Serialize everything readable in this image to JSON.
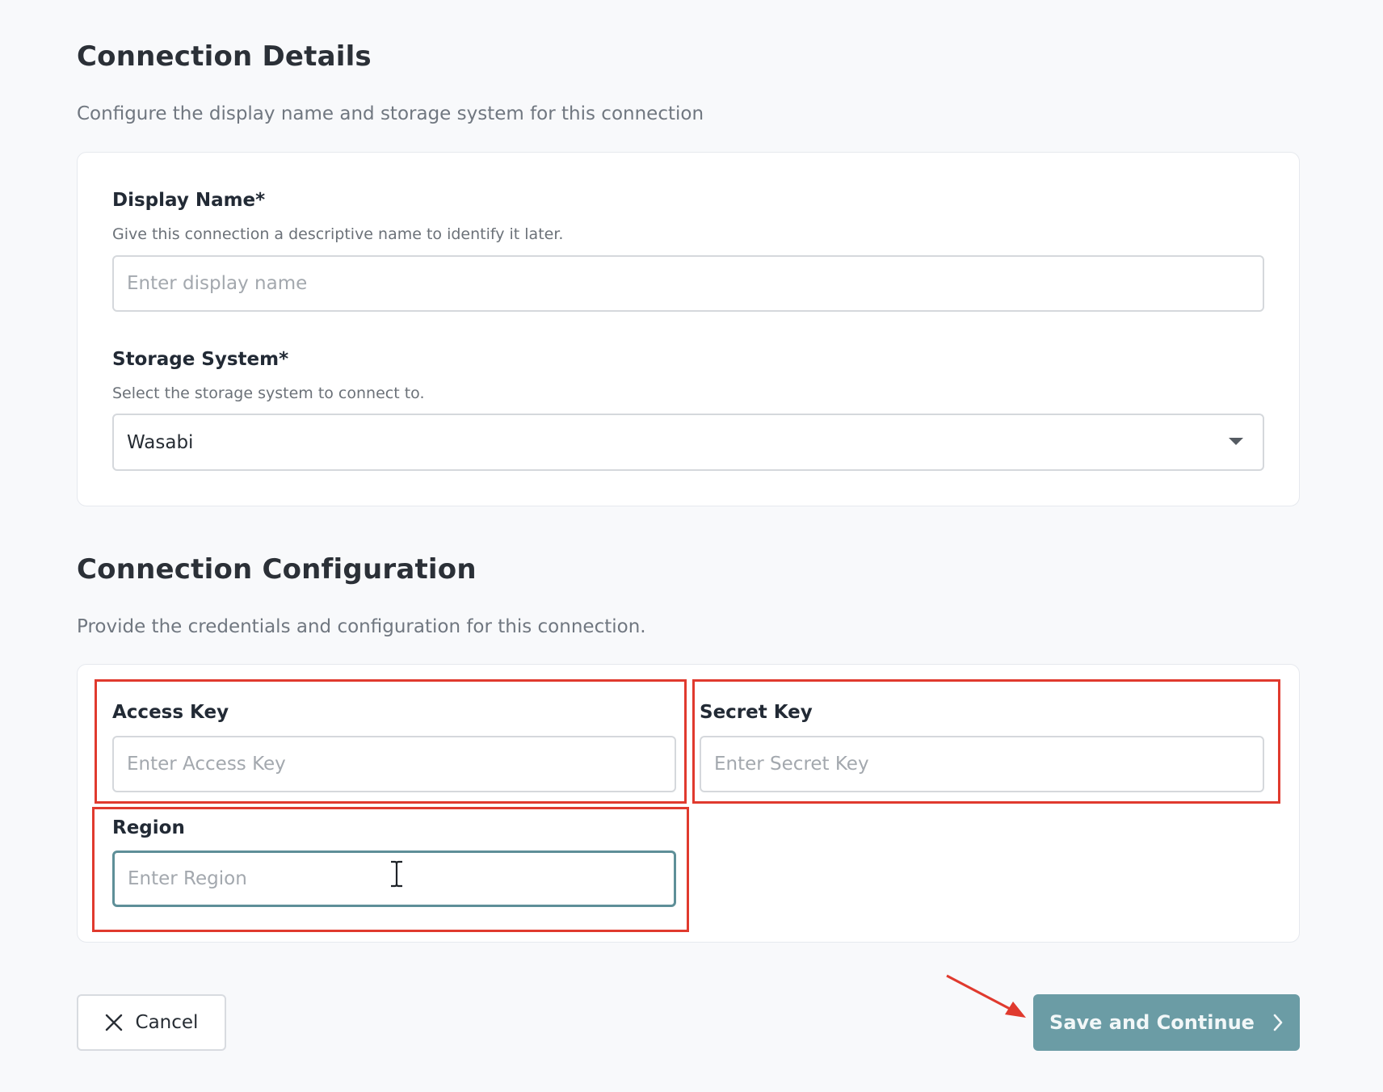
{
  "connection_details": {
    "title": "Connection Details",
    "description": "Configure the display name and storage system for this connection",
    "display_name": {
      "label": "Display Name*",
      "help": "Give this connection a descriptive name to identify it later.",
      "placeholder": "Enter display name",
      "value": ""
    },
    "storage_system": {
      "label": "Storage System*",
      "help": "Select the storage system to connect to.",
      "selected": "Wasabi"
    }
  },
  "connection_configuration": {
    "title": "Connection Configuration",
    "description": "Provide the credentials and configuration for this connection.",
    "access_key": {
      "label": "Access Key",
      "placeholder": "Enter Access Key",
      "value": ""
    },
    "secret_key": {
      "label": "Secret Key",
      "placeholder": "Enter Secret Key",
      "value": ""
    },
    "region": {
      "label": "Region",
      "placeholder": "Enter Region",
      "value": ""
    }
  },
  "actions": {
    "cancel_label": "Cancel",
    "save_label": "Save and Continue"
  },
  "colors": {
    "primary_button": "#6b9ca5",
    "focus_border": "#5e8f98",
    "annotation_red": "#e03a2e",
    "page_background": "#f8f9fb"
  },
  "icons": {
    "cancel": "close-icon",
    "save": "chevron-right-icon",
    "select": "caret-down-icon",
    "cursor": "text-cursor-icon",
    "annotation": "arrow-annotation"
  }
}
